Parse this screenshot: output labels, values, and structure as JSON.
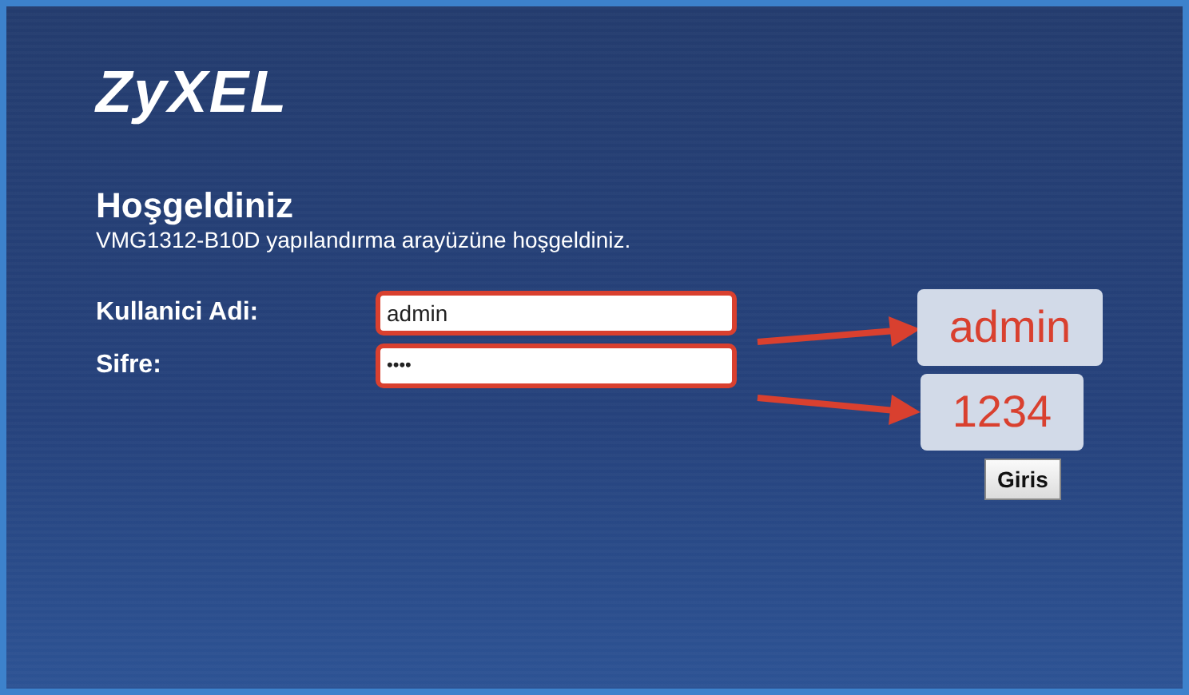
{
  "logo": "ZyXEL",
  "heading": "Hoşgeldiniz",
  "subtitle": "VMG1312-B10D yapılandırma arayüzüne hoşgeldiniz.",
  "fields": [
    {
      "label": "Kullanici Adi:",
      "value": "admin",
      "kind": "text",
      "highlighted": true
    },
    {
      "label": "Sifre:",
      "value": "••••",
      "kind": "password",
      "highlighted": true
    }
  ],
  "annotations": [
    {
      "text": "admin"
    },
    {
      "text": "1234"
    }
  ],
  "button": "Giris"
}
